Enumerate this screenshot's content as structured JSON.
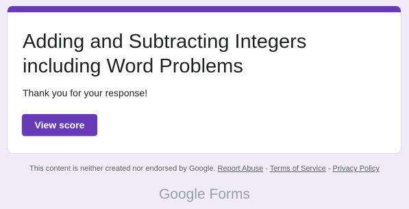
{
  "form": {
    "title": "Adding and Subtracting Integers including Word Problems",
    "confirmation_message": "Thank you for your response!",
    "view_score_label": "View score",
    "accent_color": "#673ab7",
    "background_color": "#f0ebf8"
  },
  "footer": {
    "disclaimer": "This content is neither created nor endorsed by Google.",
    "report_abuse_label": "Report Abuse",
    "separator": " - ",
    "terms_label": "Terms of Service",
    "privacy_label": "Privacy Policy"
  },
  "branding": {
    "google_text": "Google",
    "forms_text": "Forms"
  }
}
